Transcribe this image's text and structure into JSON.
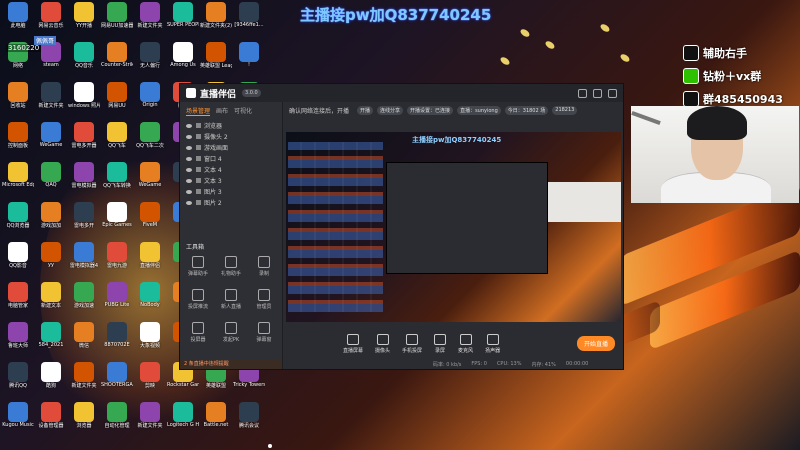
{
  "banner": "主播接pw加Q837740245",
  "user_badge": {
    "number": "3160220",
    "name": "佩佩哥"
  },
  "contacts": [
    {
      "icon": "tiktok-icon",
      "text": "辅助右手",
      "color": "#111111"
    },
    {
      "icon": "wechat-icon",
      "text": "钻粉＋vx群",
      "color": "#2dc100"
    },
    {
      "icon": "qq-icon",
      "text": "群485450943",
      "color": "#111111"
    }
  ],
  "desktop_icons": [
    [
      "此电脑",
      "网易云音乐",
      "YY开播",
      "网易UU加速器",
      "新建文件夹",
      "SUPER PEOPLE CBT",
      "新建文件夹(2)",
      "[9346ffe1..."
    ],
    [
      "网络",
      "steam",
      "QQ音乐",
      "Counter-Strike Global Off",
      "无人偏行",
      "Among Us",
      "英雄联盟 League o...",
      "!"
    ],
    [
      "回收站",
      "新建文件夹",
      "windows 照片查看器",
      "网易UU",
      "Origin",
      "腾讯",
      "",
      ""
    ],
    [
      "控制面板",
      "WeGame",
      "雷电多开器",
      "QQ飞车",
      "QQ飞车二次",
      "",
      ""
    ],
    [
      "Microsoft Edge",
      "QAQ",
      "雷电模拟器",
      "QQ飞车转换",
      "WeGame",
      "",
      ""
    ],
    [
      "QQ浏览器",
      "游戏加加",
      "雷电多开",
      "Epic Games",
      "FiveM",
      "",
      ""
    ],
    [
      "QQ影音",
      "yy",
      "雷电模拟器4",
      "雷电九游",
      "直播伴侣",
      "",
      ""
    ],
    [
      "电脑管家",
      "新建文本",
      "游戏加速",
      "PUBG Lite",
      "NoBody",
      "",
      ""
    ],
    [
      "鲁班大师",
      "584_2021",
      "微信",
      "8870702E",
      "大象视频",
      "",
      ""
    ],
    [
      "腾讯QQ",
      "酷狗",
      "新建文件夹",
      "SHOOTERGAME",
      "剪映",
      "Rockstar Games",
      "英雄联盟",
      "Tricky Towers"
    ],
    [
      "Kugou Music",
      "设备管理器",
      "浏览器",
      "自动化管理",
      "新建文件夹",
      "Logitech G HUB",
      "Battle.net",
      "腾讯会议"
    ]
  ],
  "app": {
    "name": "直播伴侣",
    "version": "3.0.0",
    "side_tabs": [
      "场景管理",
      "画布",
      "可视化"
    ],
    "scenes": [
      "浏览器",
      "摄像头 2",
      "游戏画面",
      "窗口 4",
      "文本 4",
      "文本 3",
      "图片 3",
      "图片 2"
    ],
    "tools_title": "工具箱",
    "tools": [
      "弹幕助手",
      "礼物助手",
      "录制",
      "投屏推流",
      "新人直播",
      "管理员",
      "投屏器",
      "发起PK",
      "弹幕窗"
    ],
    "alert": "2 条直播中违规提醒",
    "top_info": "确认网络连接后，开播",
    "pills": [
      "开播",
      "连线分享",
      "开播设置：已连接",
      "直播：sunyiong",
      "今日：31802 场",
      "218213"
    ],
    "preview_banner": "主播接pw加Q837740245",
    "bottom_tools": [
      "直播屏幕",
      "摄像头",
      "手机投屏",
      "录屏",
      "麦克风",
      "扬声器"
    ],
    "go_live": "开始直播",
    "status": [
      "码率: 0 kb/s",
      "FPS: 0",
      "CPU: 13%",
      "内存: 41%",
      "00:00:00"
    ]
  }
}
